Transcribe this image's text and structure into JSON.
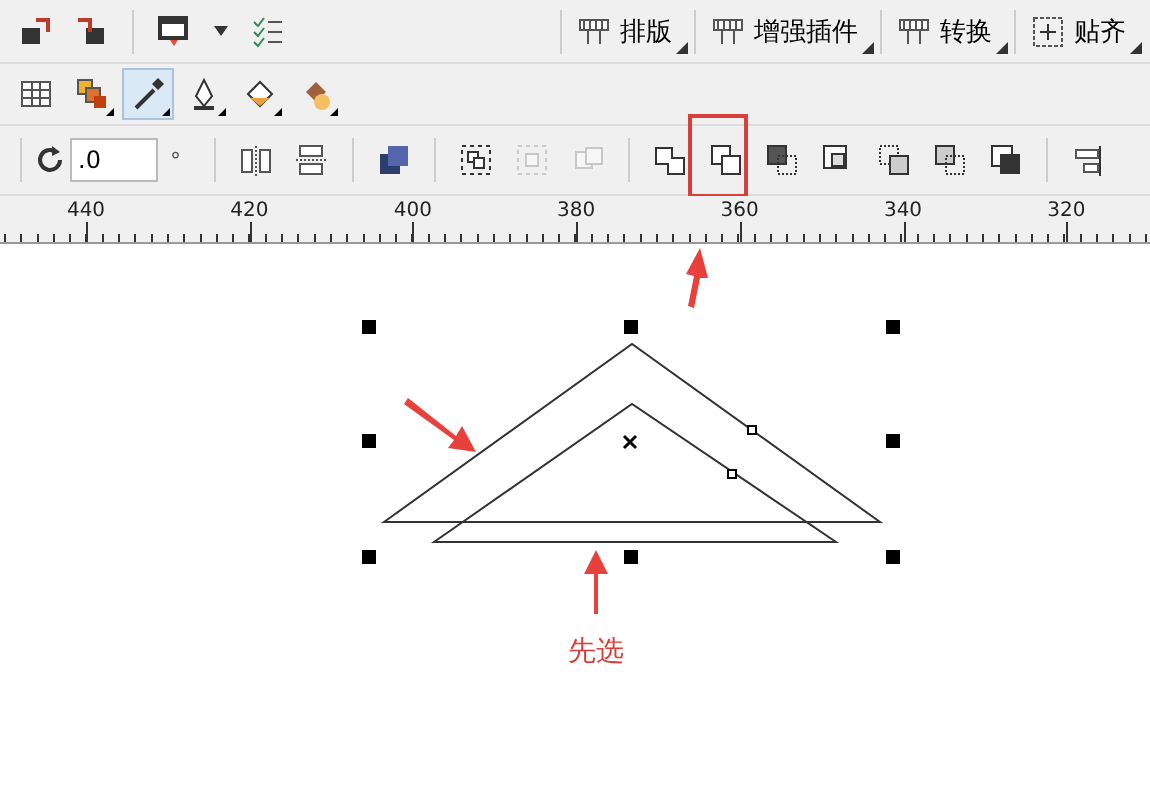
{
  "standard_bar": {
    "menus": [
      {
        "label": "排版"
      },
      {
        "label": "增强插件"
      },
      {
        "label": "转换"
      },
      {
        "label": "贴齐"
      }
    ]
  },
  "toolbox": {
    "tools": [
      {
        "selected": false
      },
      {
        "selected": false
      },
      {
        "selected": true
      },
      {
        "selected": false
      },
      {
        "selected": false
      },
      {
        "selected": false
      }
    ]
  },
  "property_bar": {
    "rotation": {
      "value": ".0",
      "unit": "°"
    },
    "group_buttons": [
      {
        "disabled": false
      },
      {
        "disabled": true
      },
      {
        "disabled": true
      }
    ],
    "shaping_buttons": [
      {
        "highlighted": false
      },
      {
        "highlighted": true
      },
      {
        "highlighted": false
      },
      {
        "highlighted": false
      },
      {
        "highlighted": false
      },
      {
        "highlighted": false
      },
      {
        "highlighted": false
      }
    ]
  },
  "ruler": {
    "labels": [
      "440",
      "420",
      "400",
      "380",
      "360",
      "340",
      "320"
    ]
  },
  "canvas": {
    "annotation": "先选"
  }
}
